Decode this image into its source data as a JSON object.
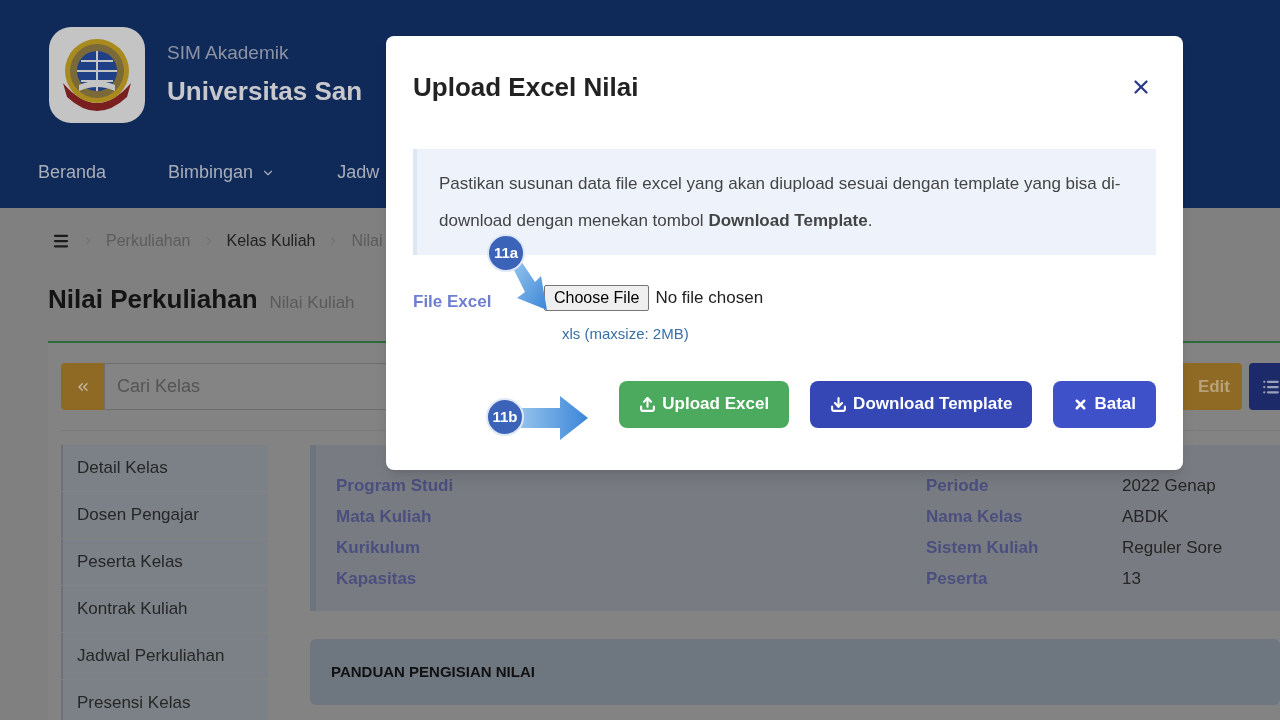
{
  "header": {
    "app_name": "SIM Akademik",
    "university": "Universitas San",
    "nav": [
      {
        "label": "Beranda",
        "dropdown": false
      },
      {
        "label": "Bimbingan",
        "dropdown": true
      },
      {
        "label": "Jadw",
        "dropdown": false
      }
    ]
  },
  "breadcrumb": [
    "Perkuliahan",
    "Kelas Kuliah",
    "Nilai"
  ],
  "page": {
    "title": "Nilai Perkuliahan",
    "subtitle": "Nilai Kuliah"
  },
  "toolbar": {
    "search_placeholder": "Cari Kelas",
    "edit_button": "Edit"
  },
  "sidebar": [
    "Detail Kelas",
    "Dosen Pengajar",
    "Peserta Kelas",
    "Kontrak Kuliah",
    "Jadwal Perkuliahan",
    "Presensi Kelas"
  ],
  "info_left": [
    {
      "label": "Program Studi"
    },
    {
      "label": "Mata Kuliah"
    },
    {
      "label": "Kurikulum"
    },
    {
      "label": "Kapasitas"
    }
  ],
  "info_right": [
    {
      "label": "Periode",
      "value": "2022 Genap"
    },
    {
      "label": "Nama Kelas",
      "value": "ABDK"
    },
    {
      "label": "Sistem Kuliah",
      "value": "Reguler Sore"
    },
    {
      "label": "Peserta",
      "value": "13"
    }
  ],
  "guide_title": "PANDUAN PENGISIAN NILAI",
  "modal": {
    "title": "Upload Excel Nilai",
    "message": "Pastikan susunan data file excel yang akan diupload sesuai dengan template yang bisa di-download dengan menekan tombol **Download Template**.",
    "field_label": "File Excel",
    "file_button": "Choose File",
    "file_status": "No file chosen",
    "hint": "xls (maxsize: 2MB)",
    "buttons": [
      {
        "label": "Upload Excel",
        "kind": "upload"
      },
      {
        "label": "Download Template",
        "kind": "download"
      },
      {
        "label": "Batal",
        "kind": "cancel"
      }
    ]
  },
  "annotations": [
    {
      "label": "11a",
      "kind": "diagonal"
    },
    {
      "label": "11b",
      "kind": "horizontal"
    }
  ]
}
